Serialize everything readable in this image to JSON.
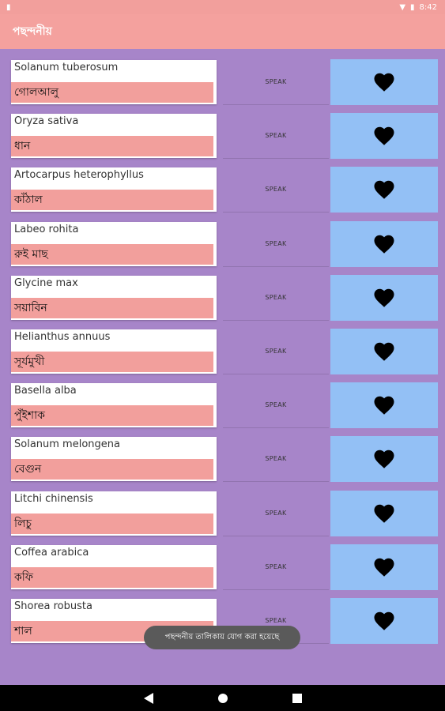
{
  "status_bar": {
    "time": "8:42"
  },
  "app_bar": {
    "title": "পছন্দনীয়"
  },
  "items": [
    {
      "scientific": "Solanum tuberosum",
      "local": "গোলআলু",
      "speak_label": "SPEAK"
    },
    {
      "scientific": "Oryza sativa",
      "local": "ধান",
      "speak_label": "SPEAK"
    },
    {
      "scientific": "Artocarpus heterophyllus",
      "local": "কাঁঠাল",
      "speak_label": "SPEAK"
    },
    {
      "scientific": "Labeo rohita",
      "local": "রুই মাছ",
      "speak_label": "SPEAK"
    },
    {
      "scientific": "Glycine max",
      "local": "সয়াবিন",
      "speak_label": "SPEAK"
    },
    {
      "scientific": "Helianthus annuus",
      "local": "সূর্যমুখী",
      "speak_label": "SPEAK"
    },
    {
      "scientific": "Basella alba",
      "local": "পুঁইশাক",
      "speak_label": "SPEAK"
    },
    {
      "scientific": "Solanum melongena",
      "local": "বেগুন",
      "speak_label": "SPEAK"
    },
    {
      "scientific": "Litchi chinensis",
      "local": "লিচু",
      "speak_label": "SPEAK"
    },
    {
      "scientific": "Coffea arabica",
      "local": "কফি",
      "speak_label": "SPEAK"
    },
    {
      "scientific": "Shorea robusta",
      "local": "শাল",
      "speak_label": "SPEAK"
    }
  ],
  "toast": {
    "message": "পছন্দনীয় তালিকায় যোগ করা হয়েছে"
  },
  "colors": {
    "app_bar": "#f4a19e",
    "background": "#a785c9",
    "local_name_bg": "#f29f9c",
    "favorite_bg": "#93c0f5"
  },
  "icons": {
    "favorite": "heart-icon",
    "back": "back-icon",
    "home": "home-icon",
    "recents": "recents-icon"
  }
}
